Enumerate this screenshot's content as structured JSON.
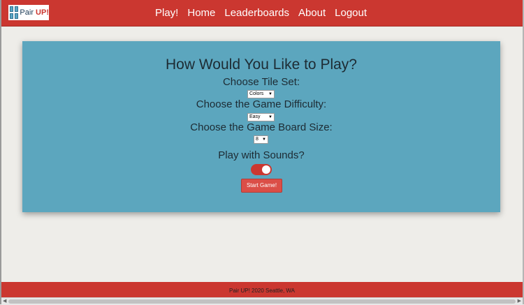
{
  "navbar": {
    "logo": {
      "text_part1": "Pair ",
      "text_part2": "UP!"
    },
    "links": [
      "Play!",
      "Home",
      "Leaderboards",
      "About",
      "Logout"
    ]
  },
  "main": {
    "heading": "How Would You Like to Play?",
    "tile_set": {
      "label": "Choose Tile Set:",
      "value": "Colors"
    },
    "difficulty": {
      "label": "Choose the Game Difficulty:",
      "value": "Easy"
    },
    "board_size": {
      "label": "Choose the Game Board Size:",
      "value": "8"
    },
    "sounds": {
      "label": "Play with Sounds?",
      "enabled": true
    },
    "start_button": "Start Game!"
  },
  "footer": {
    "text": "Pair UP! 2020 Seattle, WA"
  },
  "colors": {
    "brand_red": "#cb3730",
    "panel_blue": "#5ca6be",
    "background": "#eeede9"
  },
  "icons": {
    "logo": "tile-grid-icon",
    "dropdown": "dropdown-arrow-icon",
    "scroll_left": "scroll-left-icon",
    "scroll_right": "scroll-right-icon"
  }
}
